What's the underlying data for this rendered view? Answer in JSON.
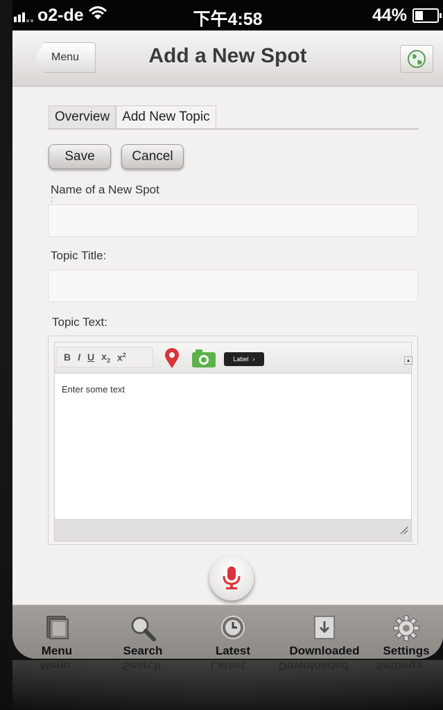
{
  "status_bar": {
    "carrier": "o2-de",
    "time": "下午4:58",
    "battery_percent": "44%",
    "battery_level": 0.44,
    "signal_icon": "signal-bars-icon",
    "wifi_icon": "wifi-icon",
    "battery_icon": "battery-icon"
  },
  "navbar": {
    "back_label": "Menu",
    "title": "Add a New Spot",
    "right_icon": "globe-icon"
  },
  "tabs": [
    {
      "label": "Overview",
      "active": true
    },
    {
      "label": "Add New Topic",
      "active": false
    }
  ],
  "actions": {
    "save_label": "Save",
    "cancel_label": "Cancel"
  },
  "form": {
    "spot_name_label": "Name of a New Spot",
    "spot_name_suffix": ":",
    "spot_name_value": "",
    "topic_title_label": "Topic Title:",
    "topic_title_value": "",
    "topic_text_label": "Topic Text:"
  },
  "editor": {
    "toolbar": {
      "bold": "B",
      "italic": "I",
      "underline": "U",
      "subscript": "x",
      "sub_digit": "2",
      "superscript": "x",
      "sup_digit": "2",
      "pin_icon": "map-pin-icon",
      "camera_icon": "camera-icon",
      "label_button": "Label",
      "label_arrow": "›"
    },
    "placeholder_text": "Enter some text",
    "scroll_up_glyph": "▴"
  },
  "mic_icon": "microphone-icon",
  "tab_bar": [
    {
      "label": "Menu",
      "icon": "menu-pages-icon"
    },
    {
      "label": "Search",
      "icon": "search-icon"
    },
    {
      "label": "Latest",
      "icon": "clock-icon"
    },
    {
      "label": "Downloaded",
      "icon": "download-icon"
    },
    {
      "label": "Settings",
      "icon": "gear-icon"
    }
  ],
  "colors": {
    "accent_red": "#d9343a",
    "camera_green": "#5bb14a",
    "status_bar_bg": "#050505"
  }
}
